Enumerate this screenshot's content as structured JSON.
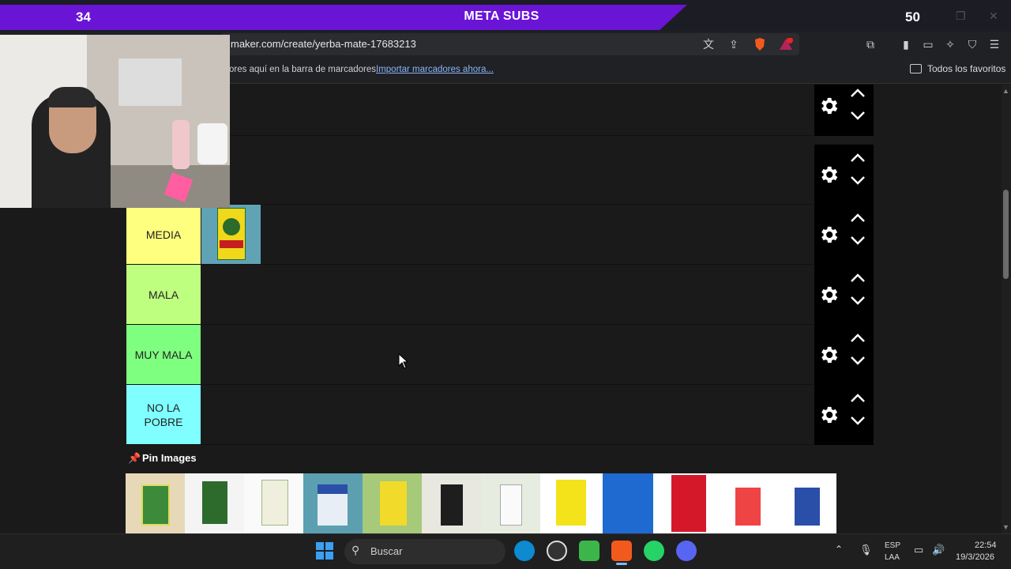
{
  "overlay": {
    "left_count": "34",
    "title": "META SUBS",
    "right_count": "50"
  },
  "browser": {
    "url": "maker.com/create/yerba-mate-17683213",
    "bookmarks_hint": "ores aquí en la barra de marcadores.",
    "bookmarks_import": "Importar marcadores ahora...",
    "all_favorites": "Todos los favoritos"
  },
  "tiers": [
    {
      "label": "",
      "color": "#1a1a1a"
    },
    {
      "label": "",
      "color": "#1a1a1a"
    },
    {
      "label": "MEDIA",
      "color": "#ffff7f"
    },
    {
      "label": "MALA",
      "color": "#bfff7f"
    },
    {
      "label": "MUY MALA",
      "color": "#7fff7f"
    },
    {
      "label": "NO LA POBRE",
      "color": "#7fffff"
    }
  ],
  "pin_images": {
    "label": "Pin Images",
    "items": [
      "canarias-green",
      "canarias-classic",
      "canarias-white",
      "baldo",
      "export",
      "premium",
      "classica",
      "pindare",
      "sara-blue",
      "sara-red",
      "rosamonte-red",
      "rosamonte-blue"
    ]
  },
  "taskbar": {
    "search_placeholder": "Buscar",
    "lang_line1": "ESP",
    "lang_line2": "LAA",
    "time": "22:54",
    "date": "19/3/2026"
  }
}
